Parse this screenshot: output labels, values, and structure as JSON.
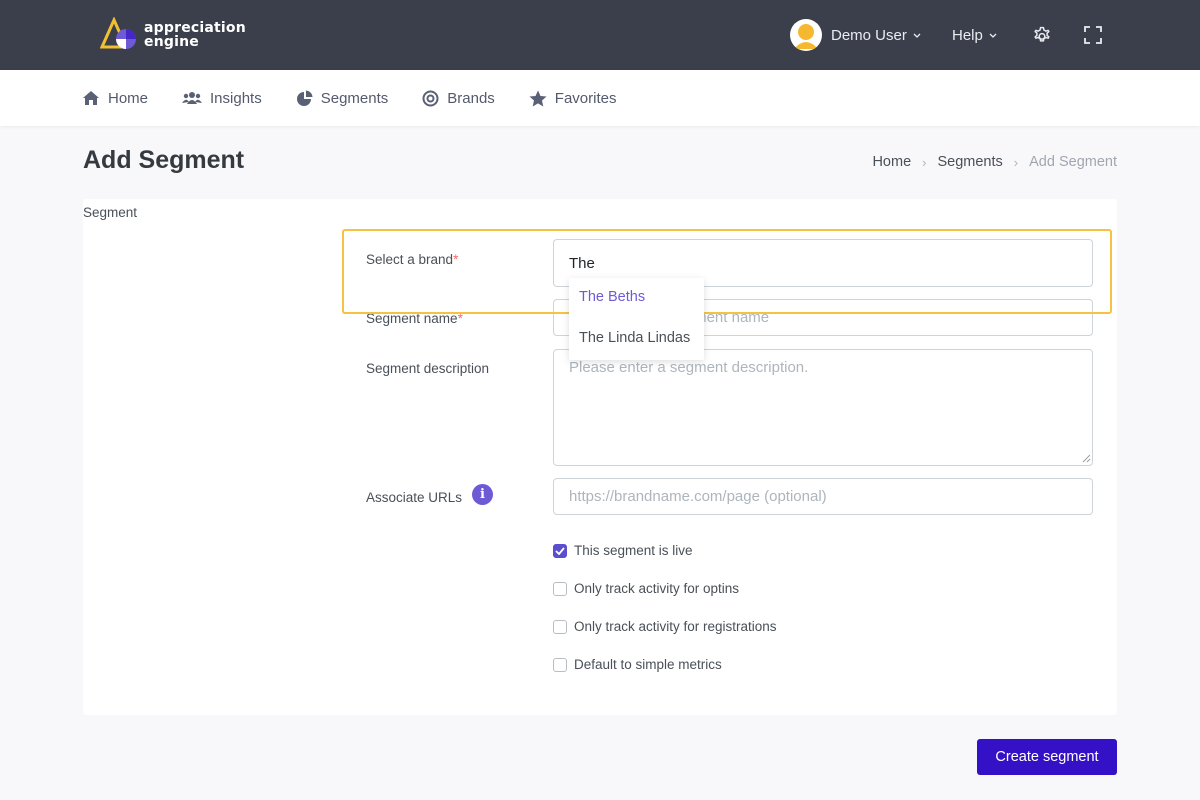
{
  "app": {
    "logo_line1": "appreciation",
    "logo_line2": "engine"
  },
  "topbar": {
    "user_name": "Demo User",
    "help_label": "Help"
  },
  "nav": {
    "items": [
      {
        "label": "Home",
        "icon": "home-icon"
      },
      {
        "label": "Insights",
        "icon": "users-icon"
      },
      {
        "label": "Segments",
        "icon": "pie-chart-icon"
      },
      {
        "label": "Brands",
        "icon": "target-icon"
      },
      {
        "label": "Favorites",
        "icon": "star-icon"
      }
    ]
  },
  "page": {
    "title": "Add Segment",
    "section_label": "Segment",
    "breadcrumb": [
      "Home",
      "Segments",
      "Add Segment"
    ]
  },
  "form": {
    "brand": {
      "label": "Select a brand",
      "required_mark": "*",
      "value": "The"
    },
    "brand_suggestions": [
      "The Beths",
      "The Linda Lindas"
    ],
    "segment_name": {
      "label": "Segment name",
      "required_mark": "*",
      "placeholder": "Please enter a segment name",
      "value": ""
    },
    "segment_description": {
      "label": "Segment description",
      "placeholder": "Please enter a segment description.",
      "value": ""
    },
    "associate_urls": {
      "label": "Associate URLs",
      "placeholder": "https://brandname.com/page (optional)",
      "value": ""
    },
    "checkboxes": [
      {
        "label": "This segment is live",
        "checked": true
      },
      {
        "label": "Only track activity for optins",
        "checked": false
      },
      {
        "label": "Only track activity for registrations",
        "checked": false
      },
      {
        "label": "Default to simple metrics",
        "checked": false
      }
    ],
    "submit_label": "Create segment"
  },
  "colors": {
    "topbar_bg": "#3b3f4c",
    "accent": "#6f5ad6",
    "primary_button": "#3410c6",
    "highlight": "#f5c342",
    "required": "#f46a6a"
  }
}
